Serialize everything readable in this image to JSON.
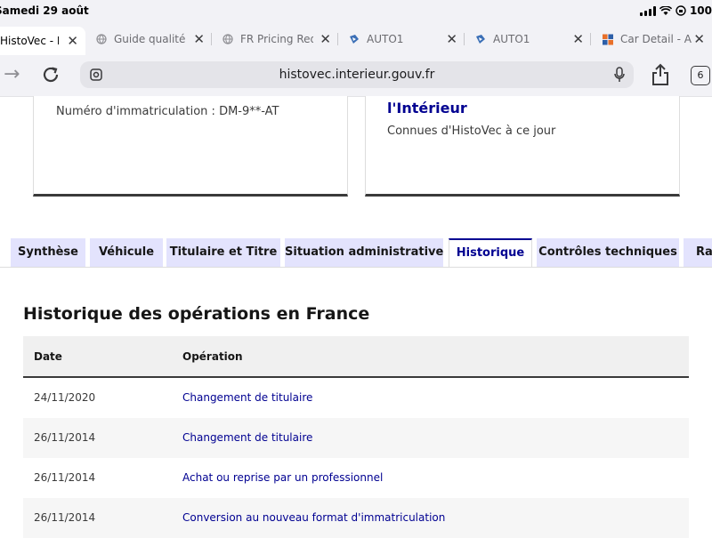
{
  "status_bar": {
    "date": "Samedi 29 août",
    "battery_text": "100"
  },
  "browser_tabs": [
    {
      "label": "HistoVec - Rap",
      "active": true,
      "icon": "none"
    },
    {
      "label": "Guide qualité -",
      "active": false,
      "icon": "globe-icon"
    },
    {
      "label": "FR Pricing Req",
      "active": false,
      "icon": "globe-icon"
    },
    {
      "label": "AUTO1",
      "active": false,
      "icon": "auto1-icon"
    },
    {
      "label": "AUTO1",
      "active": false,
      "icon": "auto1-icon"
    },
    {
      "label": "Car Detail - Ad",
      "active": false,
      "icon": "car-detail-icon"
    }
  ],
  "address_bar": {
    "url": "histovec.interieur.gouv.fr",
    "tab_count": "6"
  },
  "cards": {
    "left": {
      "plate_text": "Numéro d'immatriculation : DM-9**-AT"
    },
    "right": {
      "ministry_text": "l'Intérieur",
      "known_text": "Connues d'HistoVec à ce jour"
    }
  },
  "nav_tabs": [
    {
      "label": "Synthèse",
      "active": false
    },
    {
      "label": "Véhicule",
      "active": false
    },
    {
      "label": "Titulaire et Titre",
      "active": false
    },
    {
      "label": "Situation administrative",
      "active": false
    },
    {
      "label": "Historique",
      "active": true
    },
    {
      "label": "Contrôles techniques",
      "active": false
    },
    {
      "label": "Rap",
      "active": false
    }
  ],
  "history": {
    "title": "Historique des opérations en France",
    "columns": [
      "Date",
      "Opération"
    ],
    "rows": [
      {
        "date": "24/11/2020",
        "operation": "Changement de titulaire"
      },
      {
        "date": "26/11/2014",
        "operation": "Changement de titulaire"
      },
      {
        "date": "26/11/2014",
        "operation": "Achat ou reprise par un professionnel"
      },
      {
        "date": "26/11/2014",
        "operation": "Conversion au nouveau format d'immatriculation"
      }
    ]
  },
  "colors": {
    "accent": "#000091",
    "tab_bg": "#e3e3fd",
    "row_alt": "#f6f6f6"
  }
}
